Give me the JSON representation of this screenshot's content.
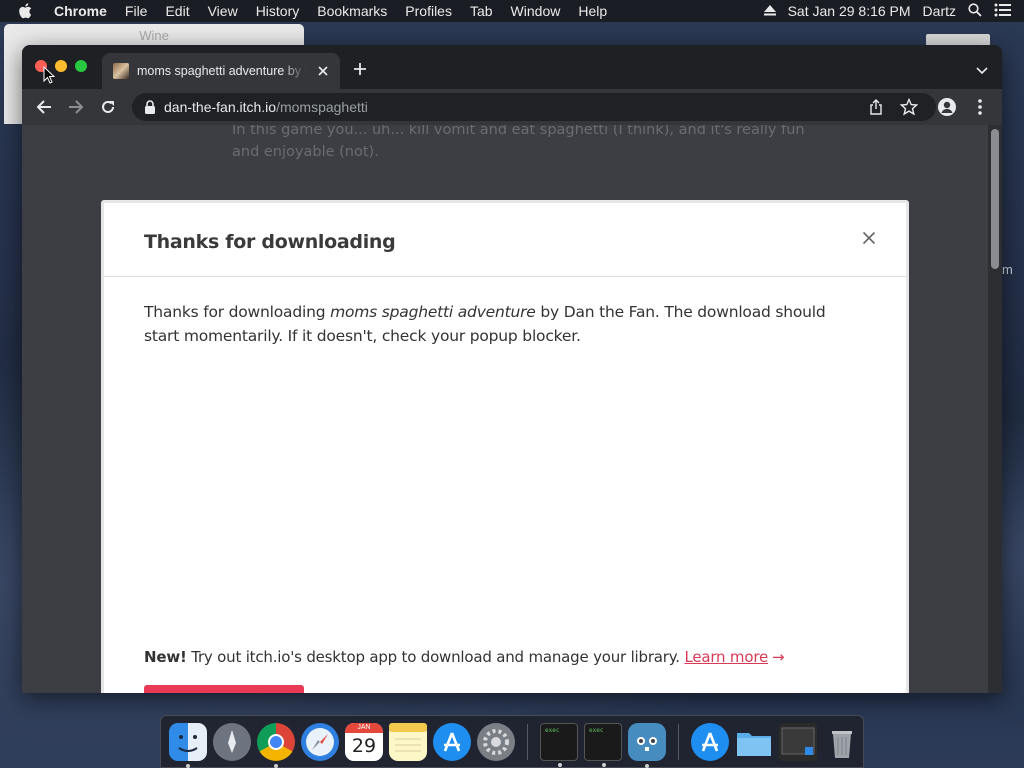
{
  "menubar": {
    "app_name": "Chrome",
    "items": [
      "File",
      "Edit",
      "View",
      "History",
      "Bookmarks",
      "Profiles",
      "Tab",
      "Window",
      "Help"
    ],
    "datetime": "Sat Jan 29  8:16 PM",
    "user": "Dartz"
  },
  "background_windows": {
    "wine_title": "Wine",
    "right_fragment": "m"
  },
  "browser": {
    "tab_title": "moms spaghetti adventure by Dan the Fan",
    "url_host": "dan-the-fan.itch.io",
    "url_path": "/momspaghetti"
  },
  "page": {
    "background_text": "In this game you... uh... kill vomit and eat spaghetti (I think), and it's really fun and enjoyable (not).",
    "modal": {
      "title": "Thanks for downloading",
      "body_prefix": "Thanks for downloading ",
      "game_name": "moms spaghetti adventure",
      "body_suffix": " by Dan the Fan. The download should start momentarily. If it doesn't, check your popup blocker.",
      "promo_new": "New!",
      "promo_text": " Try out itch.io's desktop app to download and manage your library. ",
      "promo_link": "Learn more",
      "promo_arrow": "→"
    }
  },
  "colors": {
    "accent_link": "#d73b56",
    "button_red": "#e83a54"
  },
  "dock": {
    "icons": [
      "finder-icon",
      "launchpad-icon",
      "chrome-icon",
      "safari-icon",
      "calendar-icon",
      "notes-icon",
      "app-store-icon",
      "system-preferences-icon",
      "terminal-exec-icon",
      "terminal-exec-icon",
      "godot-icon",
      "app-store-icon",
      "folder-icon",
      "screen-capture-icon",
      "trash-icon"
    ],
    "calendar_month": "JAN",
    "calendar_day": "29",
    "exec_label": "exec"
  }
}
